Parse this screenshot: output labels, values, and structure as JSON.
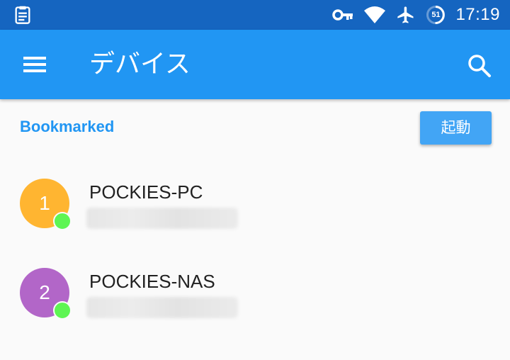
{
  "status_bar": {
    "left_icon": "clipboard-icon",
    "icons": [
      "vpn-key-icon",
      "wifi-icon",
      "airplane-mode-icon",
      "battery-saver-icon"
    ],
    "battery_level": "51",
    "time": "17:19",
    "background_color": "#1565c0"
  },
  "app_bar": {
    "menu_icon": "hamburger-menu-icon",
    "title": "デバイス",
    "search_icon": "search-icon",
    "background_color": "#2196f3"
  },
  "section": {
    "title": "Bookmarked",
    "action_label": "起動",
    "accent_color": "#2196f3"
  },
  "devices": [
    {
      "index": "1",
      "name": "POCKIES-PC",
      "avatar_color": "#ffb531",
      "status": "online",
      "status_color": "#5ef553",
      "address_blurred": true
    },
    {
      "index": "2",
      "name": "POCKIES-NAS",
      "avatar_color": "#b266c8",
      "status": "online",
      "status_color": "#5ef553",
      "address_blurred": true
    }
  ]
}
